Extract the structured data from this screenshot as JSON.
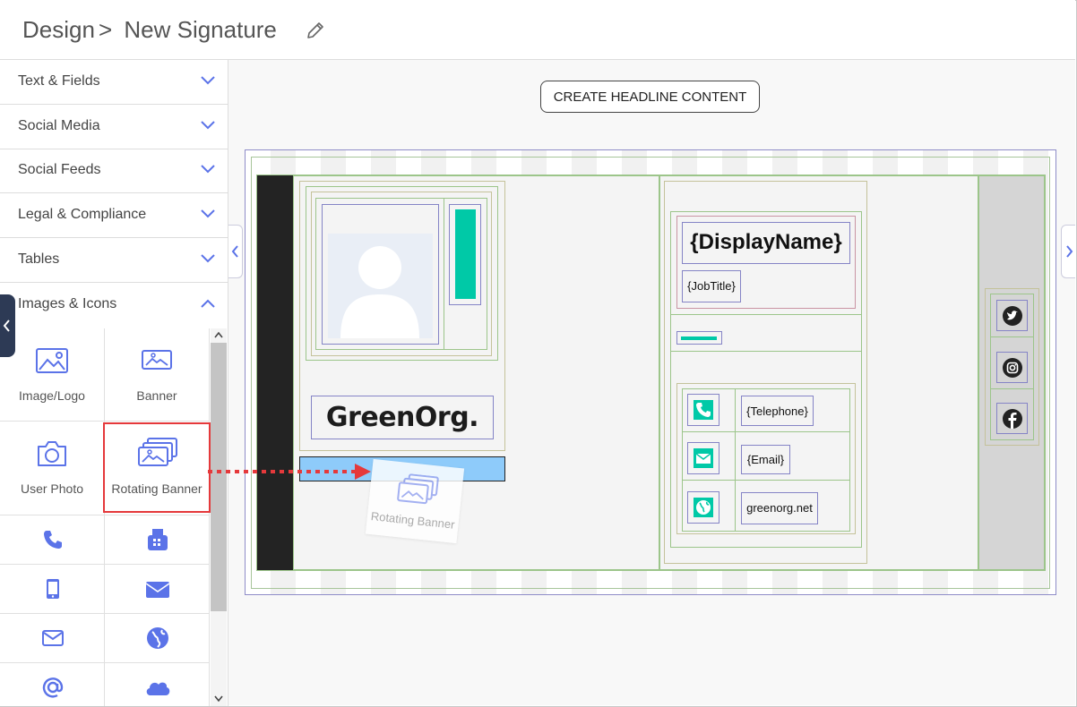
{
  "header": {
    "title_part1": "Design",
    "separator": ">",
    "title_part2": "New Signature",
    "edit_icon": "pencil-icon"
  },
  "sidebar": {
    "sections": [
      {
        "label": "Text & Fields",
        "state": "collapsed"
      },
      {
        "label": "Social Media",
        "state": "collapsed"
      },
      {
        "label": "Social Feeds",
        "state": "collapsed"
      },
      {
        "label": "Legal & Compliance",
        "state": "collapsed"
      },
      {
        "label": "Tables",
        "state": "collapsed"
      },
      {
        "label": "Images & Icons",
        "state": "expanded"
      }
    ],
    "items": [
      {
        "label": "Image/Logo",
        "icon": "image-icon"
      },
      {
        "label": "Banner",
        "icon": "banner-icon"
      },
      {
        "label": "User Photo",
        "icon": "camera-icon"
      },
      {
        "label": "Rotating Banner",
        "icon": "rotating-banner-icon"
      },
      {
        "label": "",
        "icon": "phone-icon"
      },
      {
        "label": "",
        "icon": "fax-icon"
      },
      {
        "label": "",
        "icon": "mobile-icon"
      },
      {
        "label": "",
        "icon": "envelope-filled-icon"
      },
      {
        "label": "",
        "icon": "envelope-outline-icon"
      },
      {
        "label": "",
        "icon": "globe-icon"
      },
      {
        "label": "",
        "icon": "at-icon"
      },
      {
        "label": "",
        "icon": "cloud-icon"
      }
    ]
  },
  "canvas": {
    "create_button": "CREATE HEADLINE CONTENT",
    "drag_ghost_label": "Rotating Banner",
    "logo_text": "GreenOrg.",
    "display_name": "{DisplayName}",
    "job_title": "{JobTitle}",
    "telephone": "{Telephone}",
    "email": "{Email}",
    "website": "greenorg.net",
    "social_icons": [
      "twitter-icon",
      "instagram-icon",
      "facebook-icon"
    ]
  },
  "colors": {
    "accent": "#5b73e8",
    "teal": "#00c9a7",
    "highlight": "#e5393b",
    "drop_zone": "#8ecbfa",
    "dark_bar": "#232323"
  }
}
